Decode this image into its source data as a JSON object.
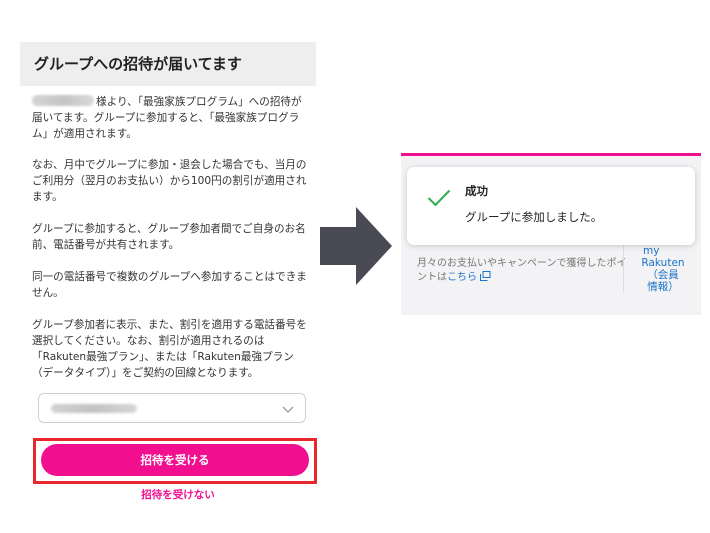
{
  "left_panel": {
    "title": "グループへの招待が届いてます",
    "intro_text": "様より、「最強家族プログラム」への招待が届いてます。グループに参加すると、「最強家族プログラム」が適用されます。",
    "paragraphs": [
      "なお、月中でグループに参加・退会した場合でも、当月のご利用分（翌月のお支払い）から100円の割引が適用されます。",
      "グループに参加すると、グループ参加者間でご自身のお名前、電話番号が共有されます。",
      "同一の電話番号で複数のグループへ参加することはできません。",
      "グループ参加者に表示、また、割引を適用する電話番号を選択してください。なお、割引が適用されるのは「Rakuten最強プラン」、または「Rakuten最強プラン（データタイプ）」をご契約の回線となります。"
    ],
    "select_icon": "chevron-down-icon",
    "accept_label": "招待を受ける",
    "decline_label": "招待を受けない"
  },
  "right_panel": {
    "toast_title": "成功",
    "toast_message": "グループに参加しました。",
    "toast_icon": "check-icon",
    "info_text": "月々のお支払いやキャンペーンで獲得したポイントは",
    "info_link": "こちら",
    "my_rakuten": [
      "my",
      "Rakuten",
      "（会員",
      "情報）"
    ]
  },
  "colors": {
    "brand_pink": "#f20f8f",
    "highlight_red": "#e8262b",
    "success_green": "#2eae4e",
    "link_blue": "#1a73c8",
    "arrow_gray": "#4a4a55"
  }
}
